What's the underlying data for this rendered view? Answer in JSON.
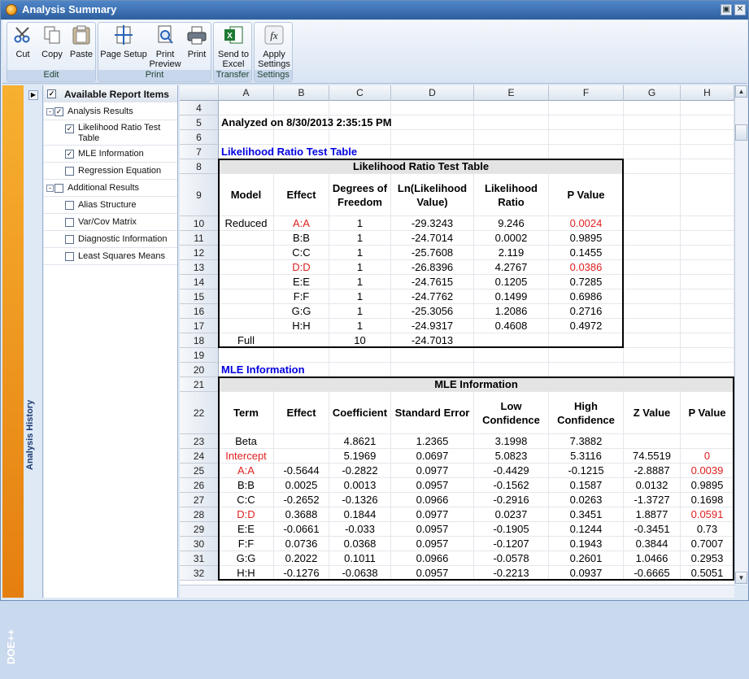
{
  "window": {
    "title": "Analysis Summary"
  },
  "ribbon": {
    "groups": [
      {
        "label": "Edit",
        "buttons": [
          "Cut",
          "Copy",
          "Paste"
        ]
      },
      {
        "label": "Print",
        "buttons": [
          "Page Setup",
          "Print Preview",
          "Print"
        ]
      },
      {
        "label": "Transfer",
        "buttons": [
          "Send to Excel"
        ]
      },
      {
        "label": "Settings",
        "buttons": [
          "Apply Settings"
        ]
      }
    ]
  },
  "side": {
    "history_label": "Analysis History",
    "logo_text": "DOE++"
  },
  "report_items": {
    "header": "Available Report Items",
    "items": [
      {
        "label": "Analysis Results",
        "checked": true,
        "level": 0,
        "expand": "-"
      },
      {
        "label": "Likelihood Ratio Test Table",
        "checked": true,
        "level": 1
      },
      {
        "label": "MLE Information",
        "checked": true,
        "level": 1
      },
      {
        "label": "Regression Equation",
        "checked": false,
        "level": 1
      },
      {
        "label": "Additional Results",
        "checked": false,
        "level": 0,
        "expand": "-"
      },
      {
        "label": "Alias Structure",
        "checked": false,
        "level": 1
      },
      {
        "label": "Var/Cov Matrix",
        "checked": false,
        "level": 1
      },
      {
        "label": "Diagnostic Information",
        "checked": false,
        "level": 1
      },
      {
        "label": "Least Squares Means",
        "checked": false,
        "level": 1
      }
    ]
  },
  "sheet": {
    "columns": [
      "A",
      "B",
      "C",
      "D",
      "E",
      "F",
      "G",
      "H"
    ],
    "rows": [
      {
        "n": "4",
        "h": 18,
        "cells": []
      },
      {
        "n": "5",
        "h": 18,
        "cells": [
          {
            "c": 0,
            "span": 4,
            "t": "Analyzed on 8/30/2013 2:35:15 PM",
            "bold": true,
            "align": "left"
          }
        ]
      },
      {
        "n": "6",
        "h": 18,
        "cells": []
      },
      {
        "n": "7",
        "h": 18,
        "cells": [
          {
            "c": 0,
            "span": 3,
            "t": "Likelihood Ratio Test Table",
            "bold": true,
            "color": "blue",
            "align": "left"
          }
        ]
      },
      {
        "n": "8",
        "h": 18,
        "cells": [
          {
            "c": 0,
            "span": 6,
            "t": "Likelihood Ratio Test Table",
            "bold": true,
            "bg": "gray"
          }
        ]
      },
      {
        "n": "9",
        "h": 52,
        "cells": [
          {
            "c": 0,
            "t": "Model",
            "bold": true
          },
          {
            "c": 1,
            "t": "Effect",
            "bold": true
          },
          {
            "c": 2,
            "t": "Degrees of Freedom",
            "bold": true
          },
          {
            "c": 3,
            "t": "Ln(Likelihood Value)",
            "bold": true
          },
          {
            "c": 4,
            "t": "Likelihood Ratio",
            "bold": true
          },
          {
            "c": 5,
            "t": "P Value",
            "bold": true
          }
        ]
      },
      {
        "n": "10",
        "h": 18,
        "cells": [
          {
            "c": 0,
            "t": "Reduced"
          },
          {
            "c": 1,
            "t": "A:A",
            "color": "red"
          },
          {
            "c": 2,
            "t": "1"
          },
          {
            "c": 3,
            "t": "-29.3243"
          },
          {
            "c": 4,
            "t": "9.246"
          },
          {
            "c": 5,
            "t": "0.0024",
            "color": "red"
          }
        ]
      },
      {
        "n": "11",
        "h": 18,
        "cells": [
          {
            "c": 1,
            "t": "B:B"
          },
          {
            "c": 2,
            "t": "1"
          },
          {
            "c": 3,
            "t": "-24.7014"
          },
          {
            "c": 4,
            "t": "0.0002"
          },
          {
            "c": 5,
            "t": "0.9895"
          }
        ]
      },
      {
        "n": "12",
        "h": 18,
        "cells": [
          {
            "c": 1,
            "t": "C:C"
          },
          {
            "c": 2,
            "t": "1"
          },
          {
            "c": 3,
            "t": "-25.7608"
          },
          {
            "c": 4,
            "t": "2.119"
          },
          {
            "c": 5,
            "t": "0.1455"
          }
        ]
      },
      {
        "n": "13",
        "h": 18,
        "cells": [
          {
            "c": 1,
            "t": "D:D",
            "color": "red"
          },
          {
            "c": 2,
            "t": "1"
          },
          {
            "c": 3,
            "t": "-26.8396"
          },
          {
            "c": 4,
            "t": "4.2767"
          },
          {
            "c": 5,
            "t": "0.0386",
            "color": "red"
          }
        ]
      },
      {
        "n": "14",
        "h": 18,
        "cells": [
          {
            "c": 1,
            "t": "E:E"
          },
          {
            "c": 2,
            "t": "1"
          },
          {
            "c": 3,
            "t": "-24.7615"
          },
          {
            "c": 4,
            "t": "0.1205"
          },
          {
            "c": 5,
            "t": "0.7285"
          }
        ]
      },
      {
        "n": "15",
        "h": 18,
        "cells": [
          {
            "c": 1,
            "t": "F:F"
          },
          {
            "c": 2,
            "t": "1"
          },
          {
            "c": 3,
            "t": "-24.7762"
          },
          {
            "c": 4,
            "t": "0.1499"
          },
          {
            "c": 5,
            "t": "0.6986"
          }
        ]
      },
      {
        "n": "16",
        "h": 18,
        "cells": [
          {
            "c": 1,
            "t": "G:G"
          },
          {
            "c": 2,
            "t": "1"
          },
          {
            "c": 3,
            "t": "-25.3056"
          },
          {
            "c": 4,
            "t": "1.2086"
          },
          {
            "c": 5,
            "t": "0.2716"
          }
        ]
      },
      {
        "n": "17",
        "h": 18,
        "cells": [
          {
            "c": 1,
            "t": "H:H"
          },
          {
            "c": 2,
            "t": "1"
          },
          {
            "c": 3,
            "t": "-24.9317"
          },
          {
            "c": 4,
            "t": "0.4608"
          },
          {
            "c": 5,
            "t": "0.4972"
          }
        ]
      },
      {
        "n": "18",
        "h": 18,
        "cells": [
          {
            "c": 0,
            "t": "Full"
          },
          {
            "c": 2,
            "t": "10"
          },
          {
            "c": 3,
            "t": "-24.7013"
          }
        ]
      },
      {
        "n": "19",
        "h": 18,
        "cells": []
      },
      {
        "n": "20",
        "h": 18,
        "cells": [
          {
            "c": 0,
            "span": 2,
            "t": "MLE Information",
            "bold": true,
            "color": "blue",
            "align": "left"
          }
        ]
      },
      {
        "n": "21",
        "h": 18,
        "cells": [
          {
            "c": 0,
            "span": 8,
            "t": "MLE Information",
            "bold": true,
            "bg": "gray"
          }
        ]
      },
      {
        "n": "22",
        "h": 52,
        "cells": [
          {
            "c": 0,
            "t": "Term",
            "bold": true
          },
          {
            "c": 1,
            "t": "Effect",
            "bold": true
          },
          {
            "c": 2,
            "t": "Coefficient",
            "bold": true
          },
          {
            "c": 3,
            "t": "Standard Error",
            "bold": true
          },
          {
            "c": 4,
            "t": "Low Confidence",
            "bold": true
          },
          {
            "c": 5,
            "t": "High Confidence",
            "bold": true
          },
          {
            "c": 6,
            "t": "Z Value",
            "bold": true
          },
          {
            "c": 7,
            "t": "P Value",
            "bold": true
          }
        ]
      },
      {
        "n": "23",
        "h": 18,
        "cells": [
          {
            "c": 0,
            "t": "Beta"
          },
          {
            "c": 2,
            "t": "4.8621"
          },
          {
            "c": 3,
            "t": "1.2365"
          },
          {
            "c": 4,
            "t": "3.1998"
          },
          {
            "c": 5,
            "t": "7.3882"
          }
        ]
      },
      {
        "n": "24",
        "h": 18,
        "cells": [
          {
            "c": 0,
            "t": "Intercept",
            "color": "red"
          },
          {
            "c": 2,
            "t": "5.1969"
          },
          {
            "c": 3,
            "t": "0.0697"
          },
          {
            "c": 4,
            "t": "5.0823"
          },
          {
            "c": 5,
            "t": "5.3116"
          },
          {
            "c": 6,
            "t": "74.5519"
          },
          {
            "c": 7,
            "t": "0",
            "color": "red"
          }
        ]
      },
      {
        "n": "25",
        "h": 18,
        "cells": [
          {
            "c": 0,
            "t": "A:A",
            "color": "red"
          },
          {
            "c": 1,
            "t": "-0.5644"
          },
          {
            "c": 2,
            "t": "-0.2822"
          },
          {
            "c": 3,
            "t": "0.0977"
          },
          {
            "c": 4,
            "t": "-0.4429"
          },
          {
            "c": 5,
            "t": "-0.1215"
          },
          {
            "c": 6,
            "t": "-2.8887"
          },
          {
            "c": 7,
            "t": "0.0039",
            "color": "red"
          }
        ]
      },
      {
        "n": "26",
        "h": 18,
        "cells": [
          {
            "c": 0,
            "t": "B:B"
          },
          {
            "c": 1,
            "t": "0.0025"
          },
          {
            "c": 2,
            "t": "0.0013"
          },
          {
            "c": 3,
            "t": "0.0957"
          },
          {
            "c": 4,
            "t": "-0.1562"
          },
          {
            "c": 5,
            "t": "0.1587"
          },
          {
            "c": 6,
            "t": "0.0132"
          },
          {
            "c": 7,
            "t": "0.9895"
          }
        ]
      },
      {
        "n": "27",
        "h": 18,
        "cells": [
          {
            "c": 0,
            "t": "C:C"
          },
          {
            "c": 1,
            "t": "-0.2652"
          },
          {
            "c": 2,
            "t": "-0.1326"
          },
          {
            "c": 3,
            "t": "0.0966"
          },
          {
            "c": 4,
            "t": "-0.2916"
          },
          {
            "c": 5,
            "t": "0.0263"
          },
          {
            "c": 6,
            "t": "-1.3727"
          },
          {
            "c": 7,
            "t": "0.1698"
          }
        ]
      },
      {
        "n": "28",
        "h": 18,
        "cells": [
          {
            "c": 0,
            "t": "D:D",
            "color": "red"
          },
          {
            "c": 1,
            "t": "0.3688"
          },
          {
            "c": 2,
            "t": "0.1844"
          },
          {
            "c": 3,
            "t": "0.0977"
          },
          {
            "c": 4,
            "t": "0.0237"
          },
          {
            "c": 5,
            "t": "0.3451"
          },
          {
            "c": 6,
            "t": "1.8877"
          },
          {
            "c": 7,
            "t": "0.0591",
            "color": "red"
          }
        ]
      },
      {
        "n": "29",
        "h": 18,
        "cells": [
          {
            "c": 0,
            "t": "E:E"
          },
          {
            "c": 1,
            "t": "-0.0661"
          },
          {
            "c": 2,
            "t": "-0.033"
          },
          {
            "c": 3,
            "t": "0.0957"
          },
          {
            "c": 4,
            "t": "-0.1905"
          },
          {
            "c": 5,
            "t": "0.1244"
          },
          {
            "c": 6,
            "t": "-0.3451"
          },
          {
            "c": 7,
            "t": "0.73"
          }
        ]
      },
      {
        "n": "30",
        "h": 18,
        "cells": [
          {
            "c": 0,
            "t": "F:F"
          },
          {
            "c": 1,
            "t": "0.0736"
          },
          {
            "c": 2,
            "t": "0.0368"
          },
          {
            "c": 3,
            "t": "0.0957"
          },
          {
            "c": 4,
            "t": "-0.1207"
          },
          {
            "c": 5,
            "t": "0.1943"
          },
          {
            "c": 6,
            "t": "0.3844"
          },
          {
            "c": 7,
            "t": "0.7007"
          }
        ]
      },
      {
        "n": "31",
        "h": 18,
        "cells": [
          {
            "c": 0,
            "t": "G:G"
          },
          {
            "c": 1,
            "t": "0.2022"
          },
          {
            "c": 2,
            "t": "0.1011"
          },
          {
            "c": 3,
            "t": "0.0966"
          },
          {
            "c": 4,
            "t": "-0.0578"
          },
          {
            "c": 5,
            "t": "0.2601"
          },
          {
            "c": 6,
            "t": "1.0466"
          },
          {
            "c": 7,
            "t": "0.2953"
          }
        ]
      },
      {
        "n": "32",
        "h": 18,
        "cells": [
          {
            "c": 0,
            "t": "H:H"
          },
          {
            "c": 1,
            "t": "-0.1276"
          },
          {
            "c": 2,
            "t": "-0.0638"
          },
          {
            "c": 3,
            "t": "0.0957"
          },
          {
            "c": 4,
            "t": "-0.2213"
          },
          {
            "c": 5,
            "t": "0.0937"
          },
          {
            "c": 6,
            "t": "-0.6665"
          },
          {
            "c": 7,
            "t": "0.5051"
          }
        ]
      }
    ]
  }
}
